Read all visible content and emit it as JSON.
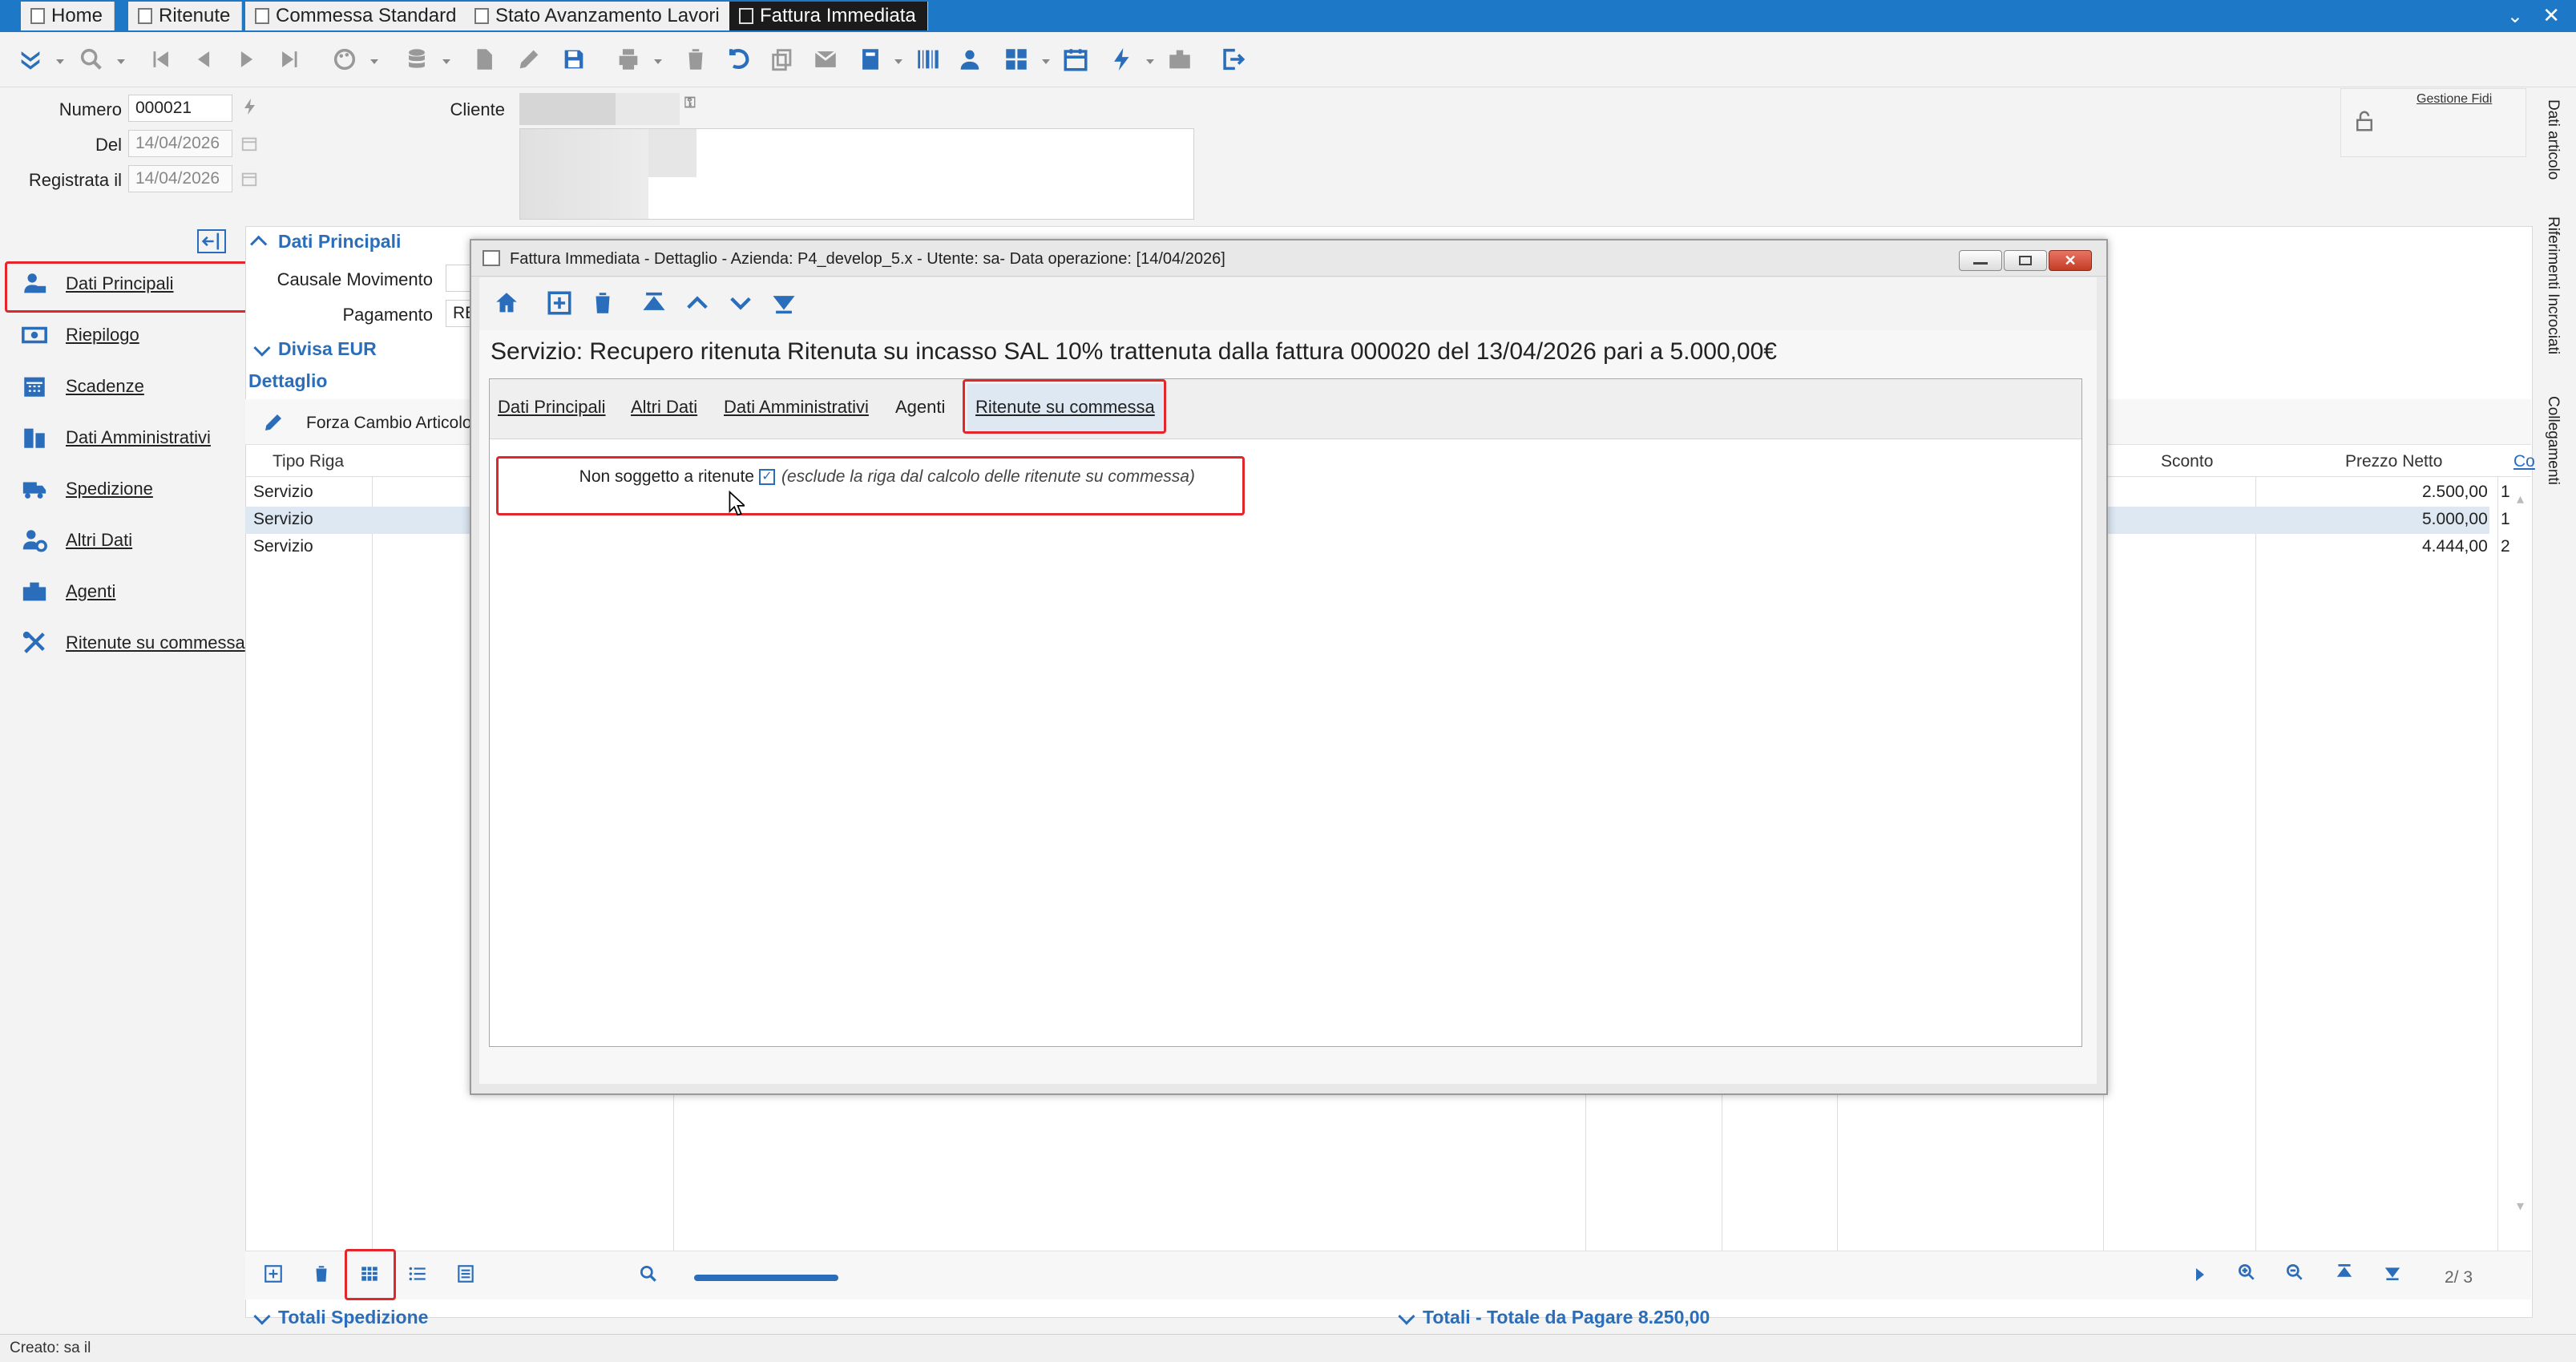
{
  "tabs": [
    {
      "label": "Home",
      "active": false
    },
    {
      "label": "Ritenute",
      "active": false
    },
    {
      "label": "Commessa Standard",
      "active": false
    },
    {
      "label": "Stato Avanzamento Lavori",
      "active": false
    },
    {
      "label": "Fattura Immediata",
      "active": true
    }
  ],
  "header": {
    "numero_label": "Numero",
    "numero_value": "000021",
    "del_label": "Del",
    "del_value": "14/04/2026",
    "registrata_label": "Registrata il",
    "registrata_value": "14/04/2026",
    "cliente_label": "Cliente",
    "gestione_fidi": "Gestione Fidi"
  },
  "right_vertical": {
    "dati_articolo": "Dati articolo",
    "riferimenti": "Riferimenti Incrociati",
    "collegamenti": "Collegamenti"
  },
  "nav": {
    "items": [
      {
        "label": "Dati Principali",
        "icon": "user-money-icon"
      },
      {
        "label": "Riepilogo",
        "icon": "money-icon"
      },
      {
        "label": "Scadenze",
        "icon": "calendar-icon"
      },
      {
        "label": "Dati Amministrativi",
        "icon": "building-icon"
      },
      {
        "label": "Spedizione",
        "icon": "truck-icon"
      },
      {
        "label": "Altri Dati",
        "icon": "user-gear-icon"
      },
      {
        "label": "Agenti",
        "icon": "briefcase-icon"
      },
      {
        "label": "Ritenute su commessa",
        "icon": "tools-icon"
      }
    ]
  },
  "main": {
    "dati_principali": "Dati Principali",
    "causale_label": "Causale Movimento",
    "pagamento_label": "Pagamento",
    "pagamento_value": "RE",
    "divisa": "Divisa EUR",
    "dettaglio": "Dettaglio",
    "forza_cambio": "Forza Cambio Articolo",
    "col_tipo_riga": "Tipo Riga",
    "col_sconto": "Sconto",
    "col_prezzo_netto": "Prezzo Netto",
    "col_extra": "Co",
    "rows": [
      {
        "tipo": "Servizio",
        "prezzo": "2.500,00",
        "extra": "1"
      },
      {
        "tipo": "Servizio",
        "prezzo": "5.000,00",
        "extra": "1"
      },
      {
        "tipo": "Servizio",
        "prezzo": "4.444,00",
        "extra": "2"
      }
    ],
    "pager": "2/ 3",
    "totali_spedizione": "Totali Spedizione",
    "totali_pagare": "Totali - Totale da Pagare 8.250,00"
  },
  "modal": {
    "title": "Fattura Immediata - Dettaglio - Azienda: P4_develop_5.x - Utente: sa- Data operazione: [14/04/2026]",
    "heading": "Servizio: Recupero ritenuta Ritenuta su incasso SAL 10% trattenuta dalla fattura 000020 del 13/04/2026 pari a 5.000,00€",
    "tabs": [
      "Dati Principali",
      "Altri Dati",
      "Dati Amministrativi",
      "Agenti",
      "Ritenute su commessa"
    ],
    "non_soggetto_label": "Non soggetto a ritenute",
    "non_soggetto_checked": true,
    "non_soggetto_hint": "(esclude la riga dal calcolo delle ritenute su commessa)"
  },
  "status": {
    "text": "Creato: sa il"
  },
  "colors": {
    "accent": "#2a6ebb",
    "tabbar": "#1e78c8",
    "highlight": "#e2262c",
    "selected_row": "#dde8f3"
  }
}
